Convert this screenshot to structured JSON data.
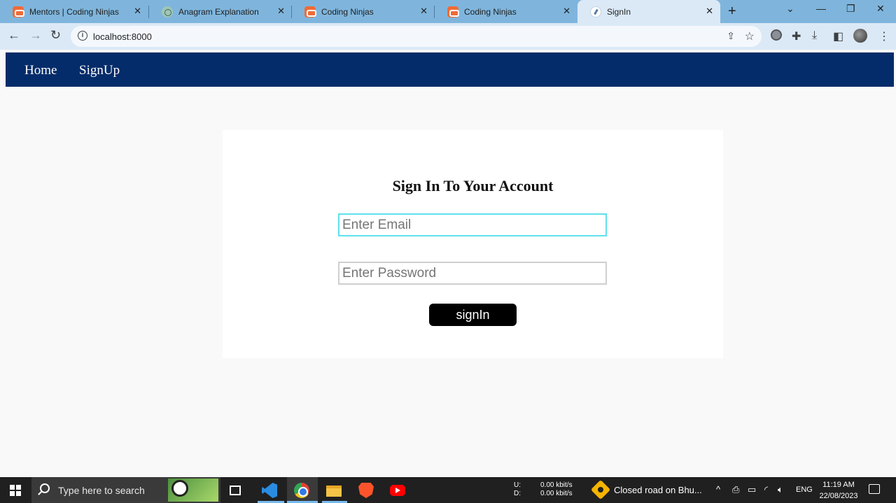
{
  "browser": {
    "tabs": [
      {
        "title": "Mentors | Coding Ninjas",
        "icon": "coding-ninjas-icon",
        "active": false
      },
      {
        "title": "Anagram Explanation",
        "icon": "chatgpt-icon",
        "active": false
      },
      {
        "title": "Coding Ninjas",
        "icon": "coding-ninjas-icon",
        "active": false
      },
      {
        "title": "Coding Ninjas",
        "icon": "coding-ninjas-icon",
        "active": false
      },
      {
        "title": "SignIn",
        "icon": "page-icon",
        "active": true
      }
    ],
    "url": "localhost:8000"
  },
  "site": {
    "nav": {
      "home": "Home",
      "signup": "SignUp"
    },
    "form": {
      "heading": "Sign In To Your Account",
      "email_placeholder": "Enter Email",
      "password_placeholder": "Enter Password",
      "submit_label": "signIn"
    }
  },
  "taskbar": {
    "search_placeholder": "Type here to search",
    "net": {
      "up_label": "U:",
      "down_label": "D:",
      "up_value": "0.00 kbit/s",
      "down_value": "0.00 kbit/s"
    },
    "news": "Closed road on Bhu...",
    "language": "ENG",
    "time": "11:19 AM",
    "date": "22/08/2023"
  },
  "colors": {
    "navbar": "#042c6a",
    "tabstrip": "#7fb5dc",
    "focus_border": "#5fe1ec",
    "button": "#000000"
  }
}
